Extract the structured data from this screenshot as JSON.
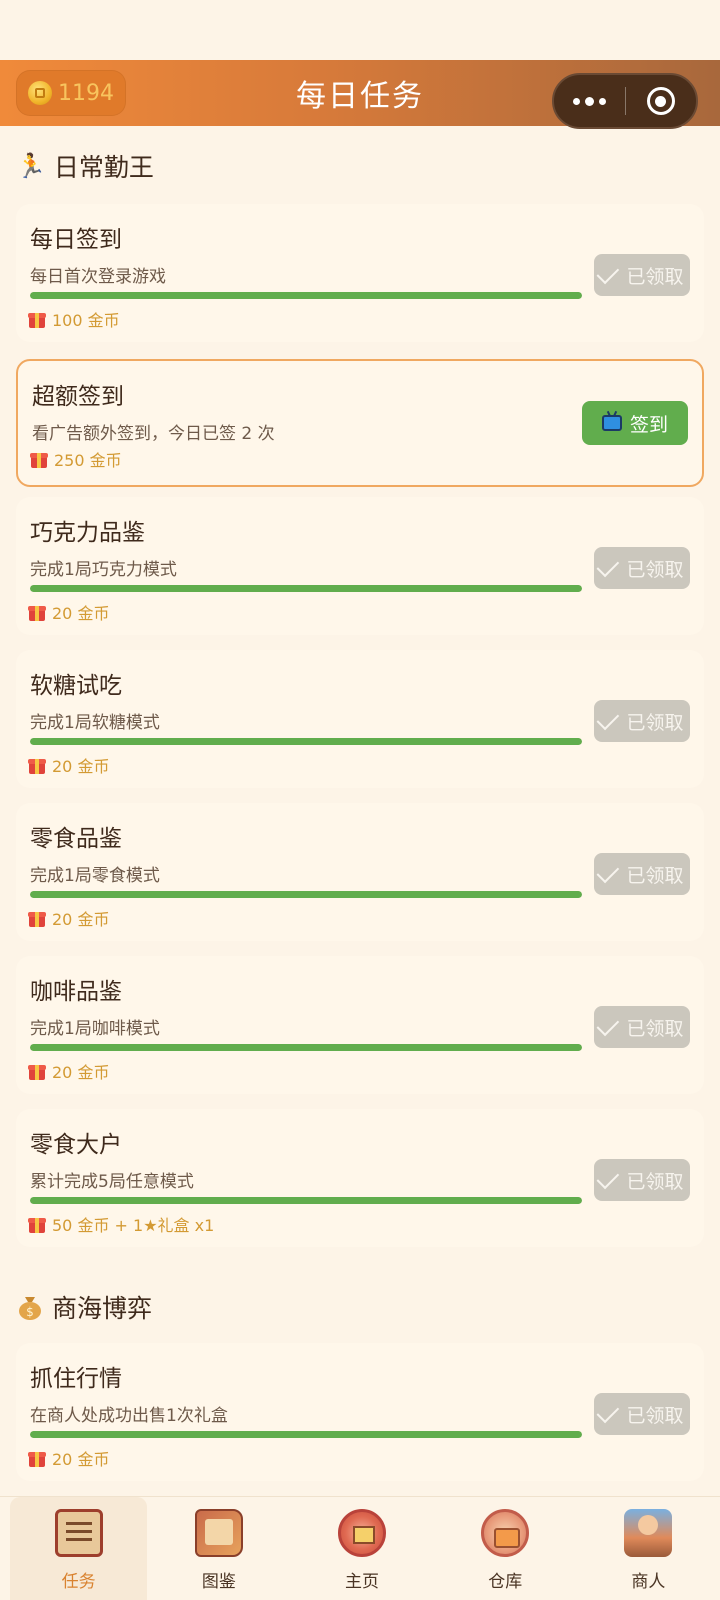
{
  "header": {
    "coins": "1194",
    "title": "每日任务"
  },
  "sections": {
    "daily": {
      "title": "日常勤王",
      "icon": "runner-icon"
    },
    "trade": {
      "title": "商海博弈",
      "icon": "money-bag-icon"
    }
  },
  "tasks": [
    {
      "title": "每日签到",
      "desc": "每日首次登录游戏",
      "reward": "100 金币",
      "progress": 1.0,
      "status": "已领取"
    },
    {
      "title": "超额签到",
      "desc": "看广告额外签到，今日已签 2 次",
      "reward": "250 金币",
      "status": "签到"
    },
    {
      "title": "巧克力品鉴",
      "desc": "完成1局巧克力模式",
      "reward": "20 金币",
      "progress": 1.0,
      "status": "已领取"
    },
    {
      "title": "软糖试吃",
      "desc": "完成1局软糖模式",
      "reward": "20 金币",
      "progress": 1.0,
      "status": "已领取"
    },
    {
      "title": "零食品鉴",
      "desc": "完成1局零食模式",
      "reward": "20 金币",
      "progress": 1.0,
      "status": "已领取"
    },
    {
      "title": "咖啡品鉴",
      "desc": "完成1局咖啡模式",
      "reward": "20 金币",
      "progress": 1.0,
      "status": "已领取"
    },
    {
      "title": "零食大户",
      "desc": "累计完成5局任意模式",
      "reward": "50 金币 + 1★礼盒 x1",
      "progress": 1.0,
      "status": "已领取"
    },
    {
      "title": "抓住行情",
      "desc": "在商人处成功出售1次礼盒",
      "reward": "20 金币",
      "progress": 1.0,
      "status": "已领取"
    }
  ],
  "tabbar": [
    {
      "label": "任务",
      "icon": "scroll-icon",
      "active": true
    },
    {
      "label": "图鉴",
      "icon": "book-icon"
    },
    {
      "label": "主页",
      "icon": "home-icon"
    },
    {
      "label": "仓库",
      "icon": "storehouse-icon"
    },
    {
      "label": "商人",
      "icon": "merchant-icon"
    }
  ],
  "colors": {
    "accent": "#e07a2a",
    "progress": "#61ad4d",
    "claimed": "#cbc7bd",
    "reward": "#d39a33"
  }
}
